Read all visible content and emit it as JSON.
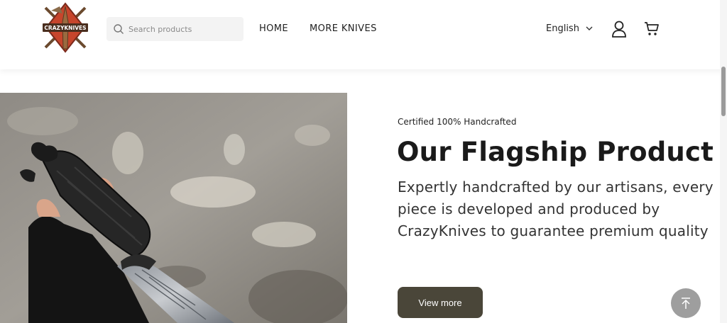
{
  "header": {
    "logo_text": "CRAZYKNIVES",
    "search": {
      "placeholder": "Search products",
      "icon": "search-icon"
    },
    "nav": [
      {
        "label": "HOME"
      },
      {
        "label": "MORE KNIVES"
      }
    ],
    "language": {
      "selected": "English",
      "icon": "chevron-down-icon"
    },
    "account_icon": "user-icon",
    "cart_icon": "cart-icon"
  },
  "hero": {
    "image": "handcrafted-knife-photo",
    "eyebrow": "Certified 100% Handcrafted",
    "title": "Our Flagship Product",
    "description": "Expertly handcrafted by our artisans, every piece is developed and produced by CrazyKnives to guarantee premium quality",
    "cta_label": "View more"
  },
  "scroll_to_top_icon": "arrow-up-icon",
  "colors": {
    "cta_background": "#4a4639",
    "scroll_top_background": "#9e9e9e",
    "logo_red": "#c7452c"
  }
}
